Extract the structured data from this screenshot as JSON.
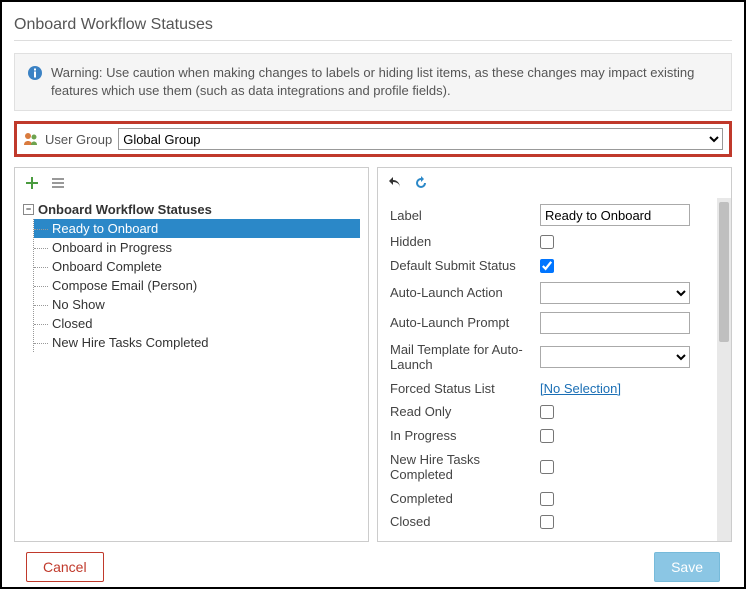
{
  "page_title": "Onboard Workflow Statuses",
  "warning": "Warning: Use caution when making changes to labels or hiding list items, as these changes may impact existing features which use them (such as data integrations and profile fields).",
  "user_group": {
    "label": "User Group",
    "selected": "Global Group"
  },
  "tree": {
    "root_label": "Onboard Workflow Statuses",
    "items": [
      {
        "label": "Ready to Onboard",
        "selected": true
      },
      {
        "label": "Onboard in Progress",
        "selected": false
      },
      {
        "label": "Onboard Complete",
        "selected": false
      },
      {
        "label": "Compose Email (Person)",
        "selected": false
      },
      {
        "label": "No Show",
        "selected": false
      },
      {
        "label": "Closed",
        "selected": false
      },
      {
        "label": "New Hire Tasks Completed",
        "selected": false
      }
    ]
  },
  "form": {
    "label_field": {
      "label": "Label",
      "value": "Ready to Onboard"
    },
    "hidden": {
      "label": "Hidden",
      "checked": false
    },
    "default_submit": {
      "label": "Default Submit Status",
      "checked": true
    },
    "auto_launch_action": {
      "label": "Auto-Launch Action",
      "value": ""
    },
    "auto_launch_prompt": {
      "label": "Auto-Launch Prompt",
      "value": ""
    },
    "mail_template": {
      "label": "Mail Template for Auto-Launch",
      "value": ""
    },
    "forced_status": {
      "label": "Forced Status List",
      "link_text": "[No Selection]"
    },
    "read_only": {
      "label": "Read Only",
      "checked": false
    },
    "in_progress": {
      "label": "In Progress",
      "checked": false
    },
    "new_hire_tasks": {
      "label": "New Hire Tasks Completed",
      "checked": false
    },
    "completed": {
      "label": "Completed",
      "checked": false
    },
    "closed": {
      "label": "Closed",
      "checked": false
    }
  },
  "buttons": {
    "cancel": "Cancel",
    "save": "Save"
  },
  "tree_toggle": "⊟"
}
